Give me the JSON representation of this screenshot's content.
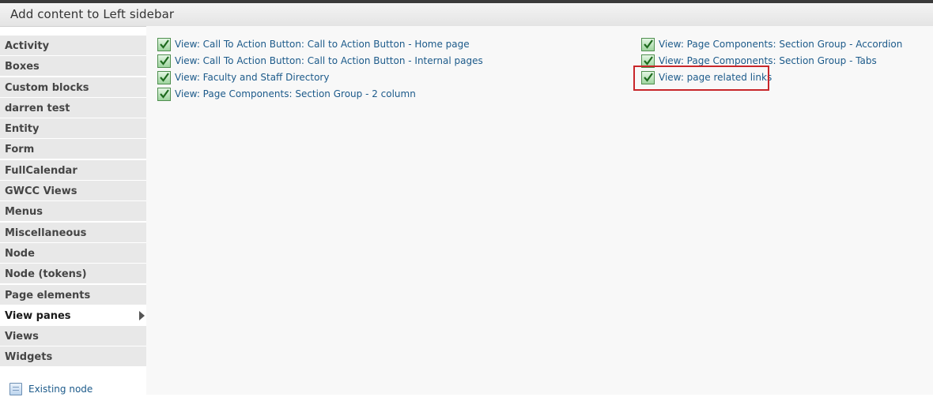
{
  "header": {
    "title": "Add content to Left sidebar"
  },
  "sidebar": {
    "categories": [
      "Activity",
      "Boxes",
      "Custom blocks",
      "darren test",
      "Entity",
      "Form",
      "FullCalendar",
      "GWCC Views",
      "Menus",
      "Miscellaneous",
      "Node",
      "Node (tokens)",
      "Page elements",
      "View panes",
      "Views",
      "Widgets"
    ],
    "active_category": "View panes",
    "existing_node_label": "Existing node"
  },
  "content": {
    "left_items": [
      "View: Call To Action Button: Call to Action Button - Home page",
      "View: Call To Action Button: Call to Action Button - Internal pages",
      "View: Faculty and Staff Directory",
      "View: Page Components: Section Group - 2 column"
    ],
    "right_items": [
      "View: Page Components: Section Group - Accordion",
      "View: Page Components: Section Group - Tabs",
      "View: page related links"
    ],
    "highlighted_item": "View: page related links"
  },
  "colors": {
    "link": "#1c5a8a",
    "highlight_border": "#c8262a",
    "sidebar_bg": "#e8e8e8",
    "content_bg": "#f8f8f8"
  }
}
